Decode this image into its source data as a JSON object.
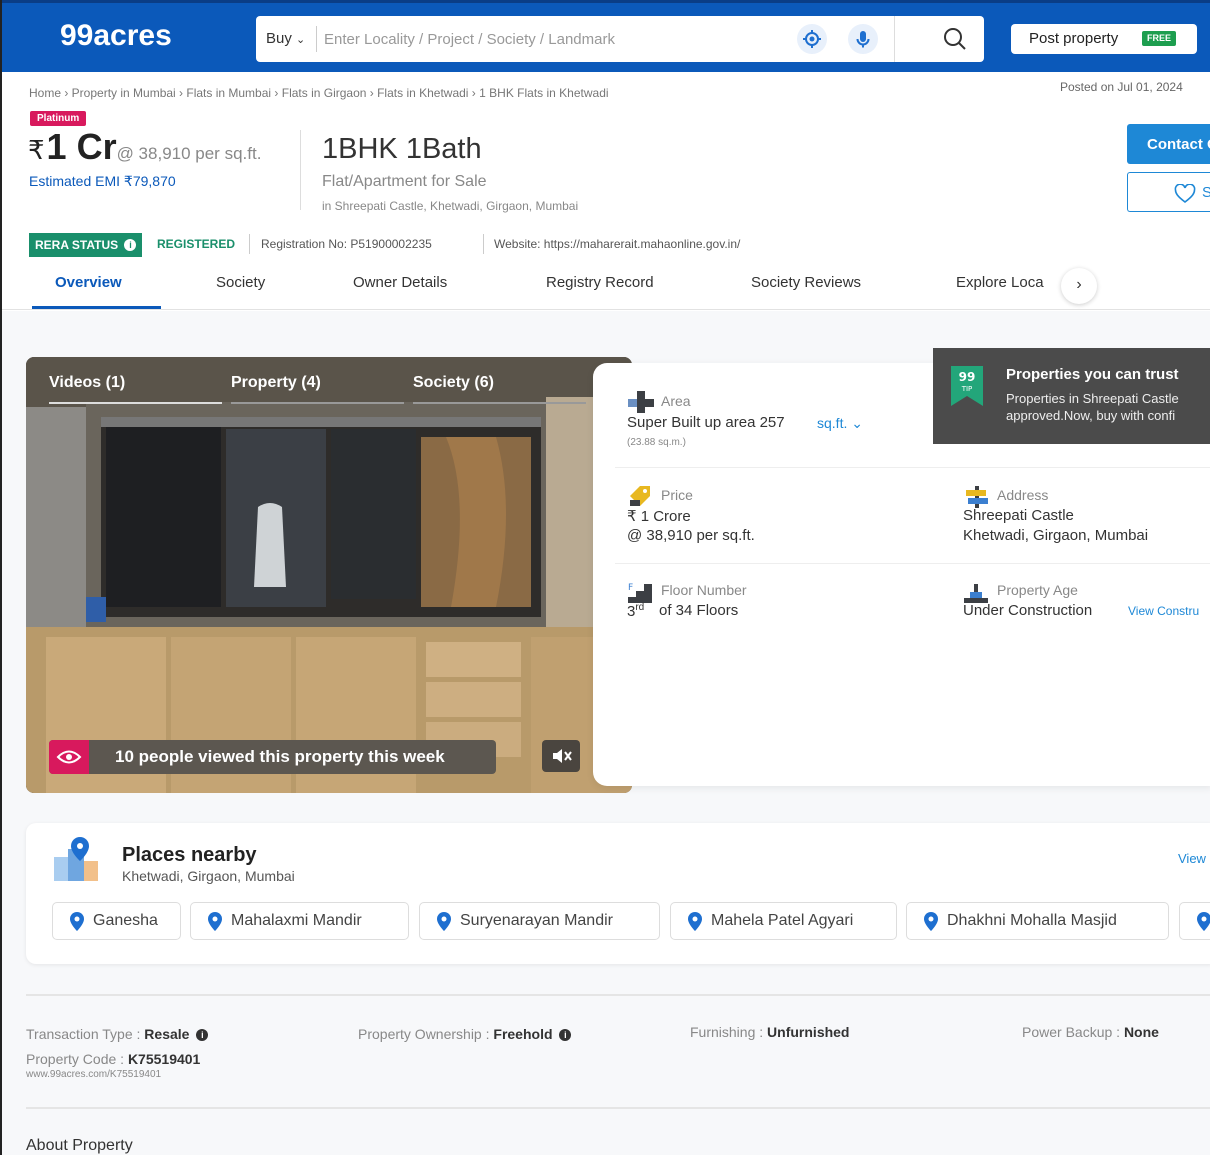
{
  "header": {
    "logo": "99acres",
    "buy_label": "Buy",
    "search_placeholder": "Enter Locality / Project / Society / Landmark",
    "post_property_label": "Post property",
    "free_badge": "FREE"
  },
  "breadcrumb": "Home › Property in Mumbai › Flats in Mumbai › Flats in Girgaon › Flats in Khetwadi › 1 BHK Flats in Khetwadi",
  "posted_on": "Posted on Jul 01, 2024",
  "listing": {
    "badge": "Platinum",
    "currency": "₹",
    "price": "1 Cr",
    "per_sqft": "@ 38,910 per sq.ft.",
    "emi": "Estimated EMI ₹79,870",
    "title": "1BHK 1Bath",
    "subtitle": "Flat/Apartment for Sale",
    "location": "in Shreepati Castle, Khetwadi, Girgaon, Mumbai",
    "contact_label": "Contact Owner",
    "shortlist_label": "Shortlist"
  },
  "rera": {
    "status_label": "RERA STATUS",
    "status_value": "REGISTERED",
    "registration": "Registration No: P51900002235",
    "website": "Website: https://maharerait.mahaonline.gov.in/"
  },
  "tabs": [
    "Overview",
    "Society",
    "Owner Details",
    "Registry Record",
    "Society Reviews",
    "Explore Loca"
  ],
  "media": {
    "tabs": [
      "Videos (1)",
      "Property (4)",
      "Society (6)"
    ],
    "viewed_text": "10 people viewed this property this week"
  },
  "details": {
    "area_label": "Area",
    "area_value": "Super Built up area 257",
    "area_unit": "sq.ft.",
    "area_sub": "(23.88 sq.m.)",
    "price_label": "Price",
    "price_value": "₹ 1 Crore",
    "price_sub": "@ 38,910 per sq.ft.",
    "address_label": "Address",
    "address_line1": "Shreepati Castle",
    "address_line2": "Khetwadi, Girgaon, Mumbai",
    "floor_label": "Floor Number",
    "floor_num": "3",
    "floor_sup": "rd",
    "floor_value": "of 34 Floors",
    "age_label": "Property Age",
    "age_value": "Under Construction",
    "age_link": "View Constru"
  },
  "trust": {
    "badge_top": "99",
    "badge_bottom": "TIP",
    "title": "Properties you can trust",
    "line1": "Properties in Shreepati Castle",
    "line2": "approved.Now, buy with confi"
  },
  "places": {
    "title": "Places nearby",
    "subtitle": "Khetwadi, Girgaon, Mumbai",
    "view_all": "View",
    "items": [
      "Ganesha",
      "Mahalaxmi Mandir",
      "Suryenarayan Mandir",
      "Mahela Patel Agyari",
      "Dhakhni Mohalla Masjid"
    ]
  },
  "facts": {
    "transaction_label": "Transaction Type : ",
    "transaction_value": "Resale",
    "ownership_label": "Property Ownership : ",
    "ownership_value": "Freehold",
    "furnishing_label": "Furnishing : ",
    "furnishing_value": "Unfurnished",
    "power_label": "Power Backup : ",
    "power_value": "None",
    "code_label": "Property Code : ",
    "code_value": "K75519401",
    "code_url": "www.99acres.com/K75519401"
  },
  "about_title": "About Property",
  "colors": {
    "brand": "#0b59ba",
    "accent": "#1e88d6",
    "badge": "#d8195d",
    "rera": "#1a8f6b"
  }
}
